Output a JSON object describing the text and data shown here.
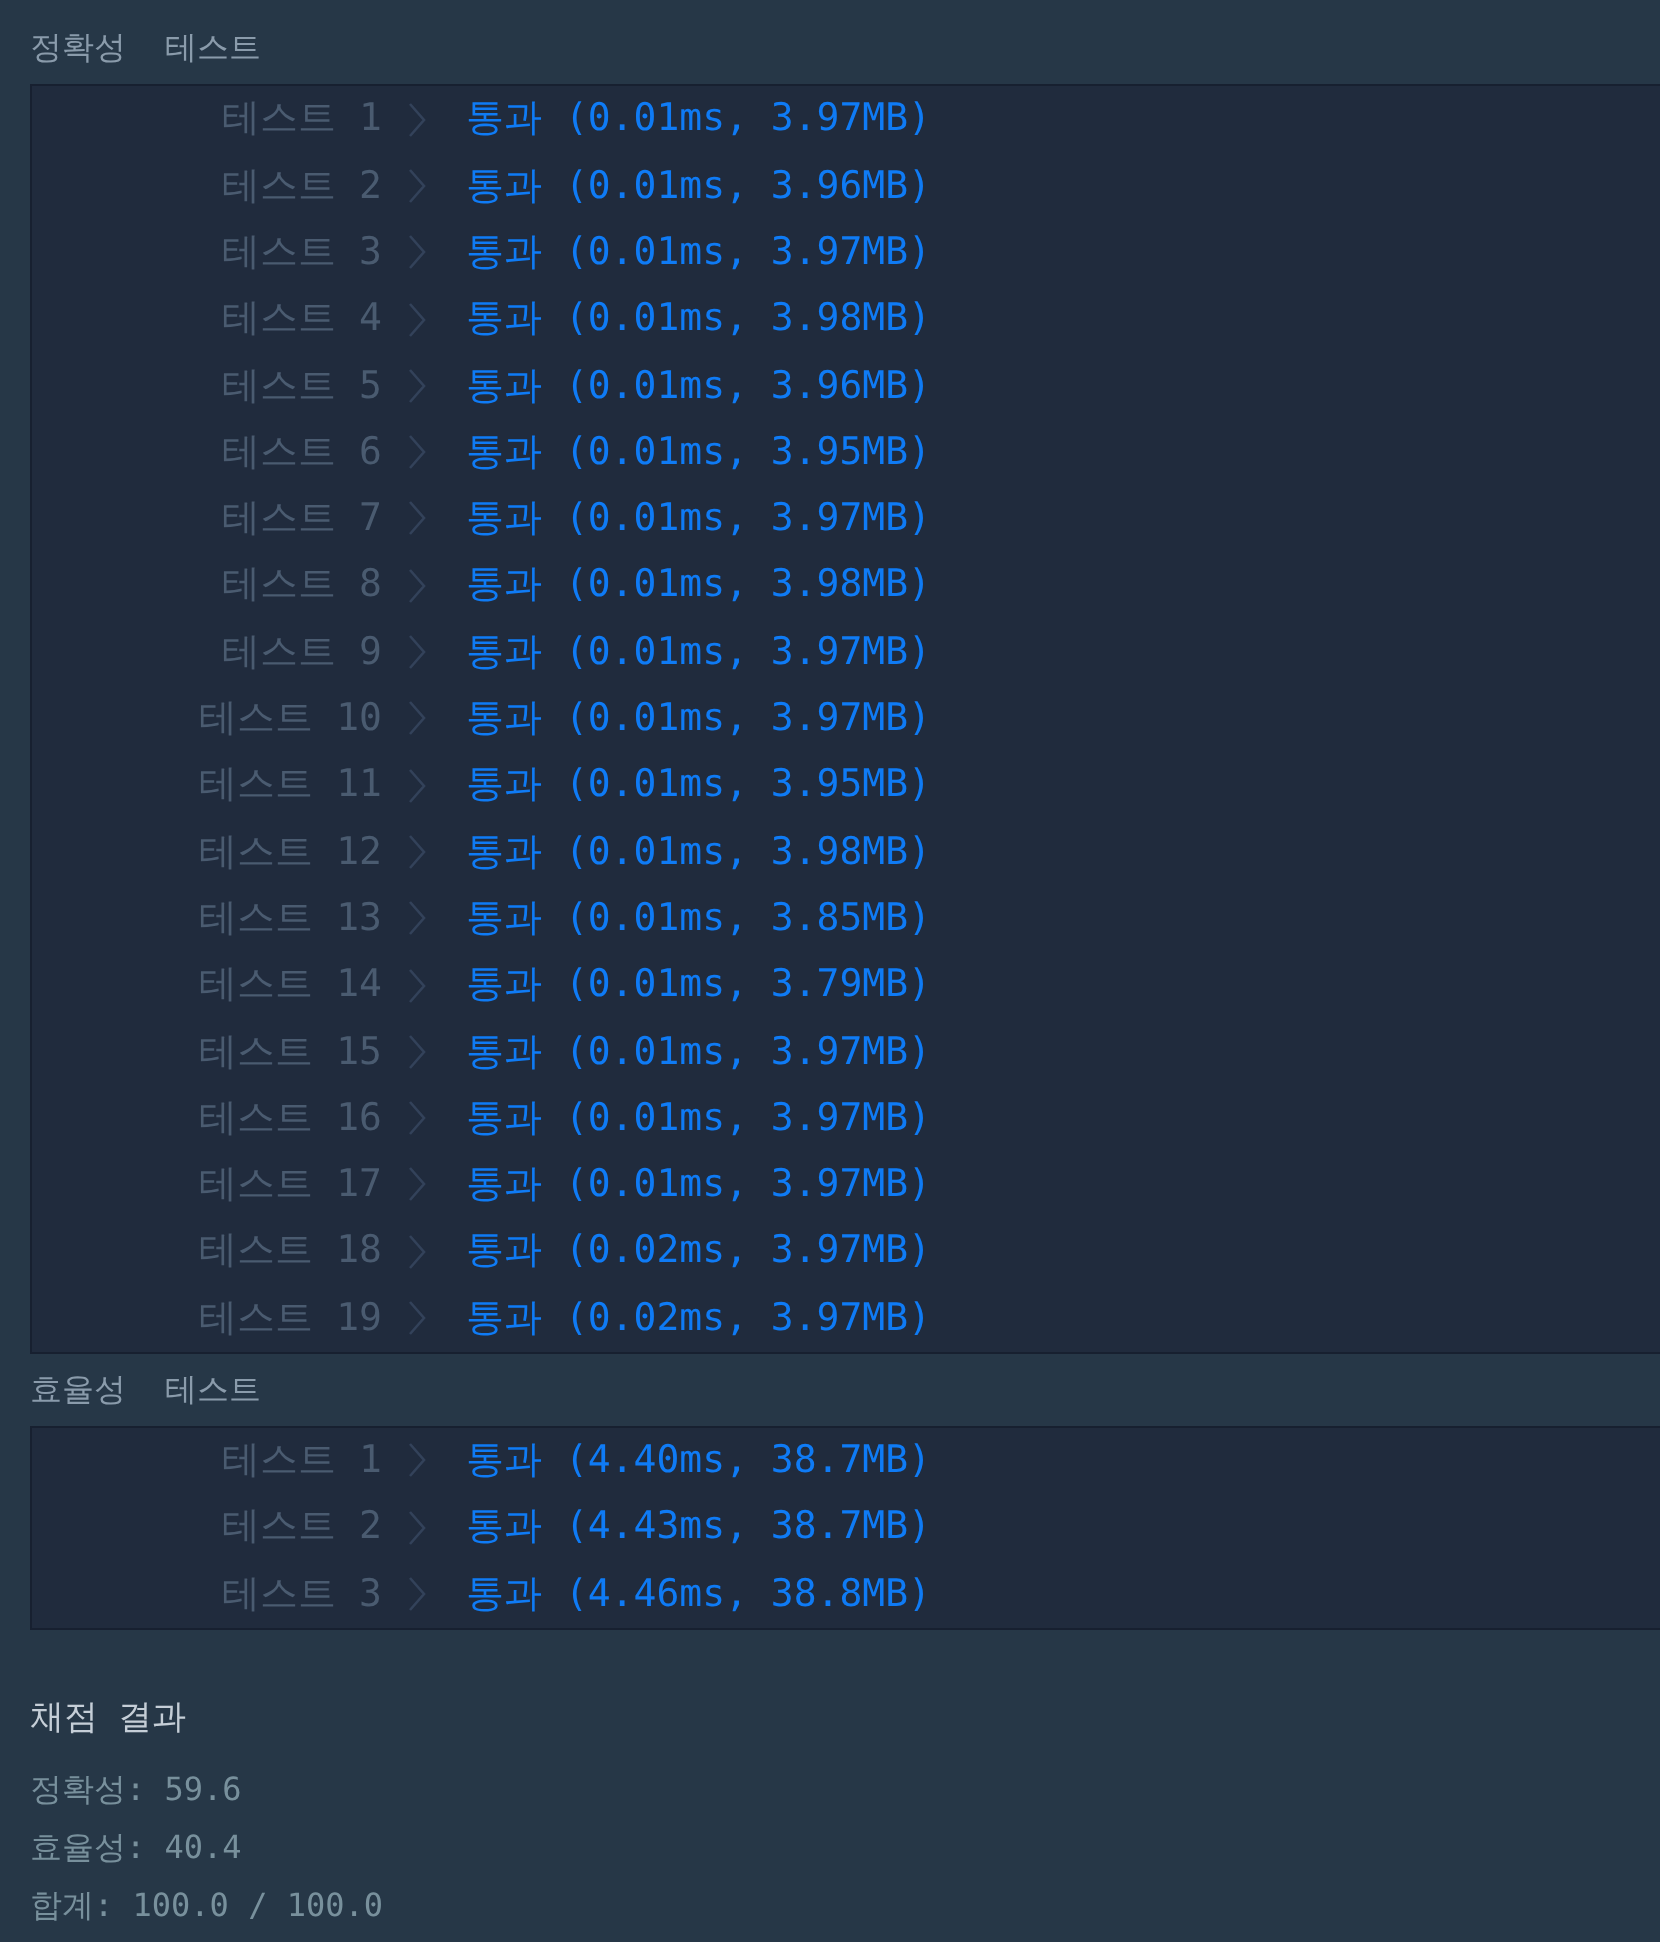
{
  "sections": [
    {
      "title": "정확성  테스트",
      "tests": [
        {
          "label": "테스트 1",
          "result": "통과 (0.01ms, 3.97MB)"
        },
        {
          "label": "테스트 2",
          "result": "통과 (0.01ms, 3.96MB)"
        },
        {
          "label": "테스트 3",
          "result": "통과 (0.01ms, 3.97MB)"
        },
        {
          "label": "테스트 4",
          "result": "통과 (0.01ms, 3.98MB)"
        },
        {
          "label": "테스트 5",
          "result": "통과 (0.01ms, 3.96MB)"
        },
        {
          "label": "테스트 6",
          "result": "통과 (0.01ms, 3.95MB)"
        },
        {
          "label": "테스트 7",
          "result": "통과 (0.01ms, 3.97MB)"
        },
        {
          "label": "테스트 8",
          "result": "통과 (0.01ms, 3.98MB)"
        },
        {
          "label": "테스트 9",
          "result": "통과 (0.01ms, 3.97MB)"
        },
        {
          "label": "테스트 10",
          "result": "통과 (0.01ms, 3.97MB)"
        },
        {
          "label": "테스트 11",
          "result": "통과 (0.01ms, 3.95MB)"
        },
        {
          "label": "테스트 12",
          "result": "통과 (0.01ms, 3.98MB)"
        },
        {
          "label": "테스트 13",
          "result": "통과 (0.01ms, 3.85MB)"
        },
        {
          "label": "테스트 14",
          "result": "통과 (0.01ms, 3.79MB)"
        },
        {
          "label": "테스트 15",
          "result": "통과 (0.01ms, 3.97MB)"
        },
        {
          "label": "테스트 16",
          "result": "통과 (0.01ms, 3.97MB)"
        },
        {
          "label": "테스트 17",
          "result": "통과 (0.01ms, 3.97MB)"
        },
        {
          "label": "테스트 18",
          "result": "통과 (0.02ms, 3.97MB)"
        },
        {
          "label": "테스트 19",
          "result": "통과 (0.02ms, 3.97MB)"
        }
      ]
    },
    {
      "title": "효율성  테스트",
      "tests": [
        {
          "label": "테스트 1",
          "result": "통과 (4.40ms, 38.7MB)"
        },
        {
          "label": "테스트 2",
          "result": "통과 (4.43ms, 38.7MB)"
        },
        {
          "label": "테스트 3",
          "result": "통과 (4.46ms, 38.8MB)"
        }
      ]
    }
  ],
  "summary": {
    "title": "채점 결과",
    "lines": [
      "정확성: 59.6",
      "효율성: 40.4",
      "합계: 100.0 / 100.0"
    ]
  }
}
